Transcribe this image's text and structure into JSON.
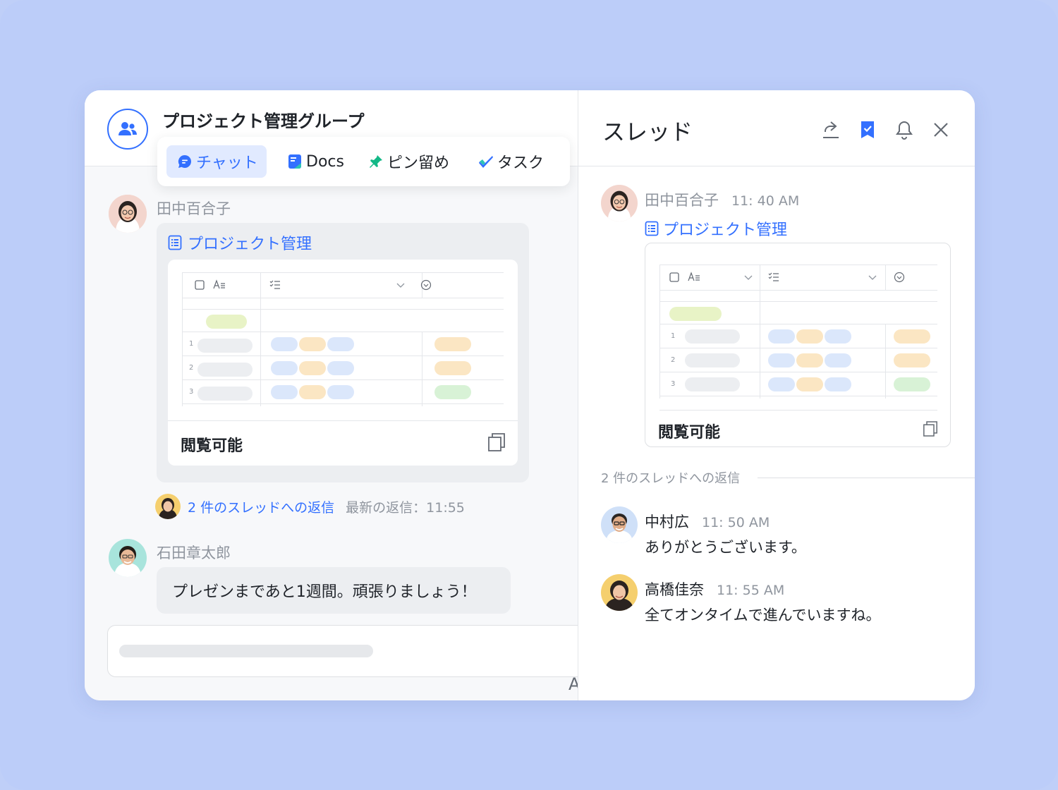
{
  "chat": {
    "group_title": "プロジェクト管理グループ",
    "tabs": [
      {
        "label": "チャット",
        "icon": "chat-bubble-icon",
        "active": true
      },
      {
        "label": "Docs",
        "icon": "docs-icon",
        "active": false
      },
      {
        "label": "ピン留め",
        "icon": "pin-icon",
        "active": false
      },
      {
        "label": "タスク",
        "icon": "task-check-icon",
        "active": false
      }
    ],
    "message1": {
      "sender": "田中百合子",
      "doc_title": "プロジェクト管理",
      "permission": "閲覧可能"
    },
    "thread_summary": {
      "link": "2 件のスレッドへの返信",
      "latest": "最新の返信：11:55"
    },
    "message2": {
      "sender": "石田章太郎",
      "text": "プレゼンまであと1週間。頑張りましょう！"
    },
    "cut_glyph": "A"
  },
  "thread": {
    "title": "スレッド",
    "header_icons": [
      "share-icon",
      "bookmark-icon",
      "bell-icon",
      "close-icon"
    ],
    "root": {
      "sender": "田中百合子",
      "time": "11: 40 AM",
      "doc_title": "プロジェクト管理",
      "permission": "閲覧可能"
    },
    "replies_label": "2 件のスレッドへの返信",
    "replies": [
      {
        "sender": "中村広",
        "time": "11: 50 AM",
        "text": "ありがとうございます。"
      },
      {
        "sender": "高橋佳奈",
        "time": "11: 55 AM",
        "text": "全てオンタイムで進んでいますね。"
      }
    ]
  },
  "colors": {
    "accent": "#3370ff",
    "background": "#bfcff8",
    "pill_green": "#e8f3c6",
    "pill_blue": "#dbe7fb",
    "pill_orange": "#fbe6c3",
    "pill_mint": "#d8f2d6"
  }
}
